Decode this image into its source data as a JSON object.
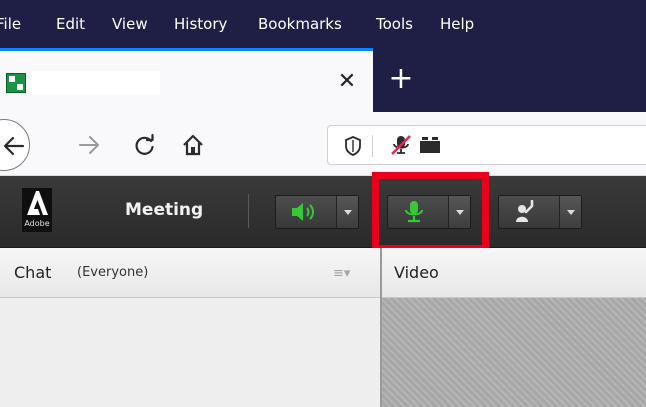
{
  "menubar": {
    "items": [
      "File",
      "Edit",
      "View",
      "History",
      "Bookmarks",
      "Tools",
      "Help"
    ]
  },
  "tabs": {
    "close_symbol": "✕",
    "new_tab_symbol": "+"
  },
  "navbar": {
    "icons": [
      "back-arrow-icon",
      "forward-arrow-icon",
      "reload-icon",
      "home-icon",
      "shield-icon",
      "microphone-blocked-icon",
      "camera-icon"
    ]
  },
  "adobe": {
    "logo_text": "Adobe",
    "meeting_label": "Meeting",
    "controls": [
      {
        "name": "speaker",
        "icon": "speaker-icon",
        "state": "on",
        "color": "#37c837"
      },
      {
        "name": "microphone",
        "icon": "microphone-icon",
        "state": "on",
        "color": "#37c837"
      },
      {
        "name": "raise-hand",
        "icon": "raise-hand-icon",
        "color": "#e6e6e6"
      }
    ],
    "highlight_color": "#e8001c"
  },
  "chat": {
    "title": "Chat",
    "audience": "(Everyone)",
    "menu_symbol": "≡▾"
  },
  "video": {
    "title": "Video"
  }
}
